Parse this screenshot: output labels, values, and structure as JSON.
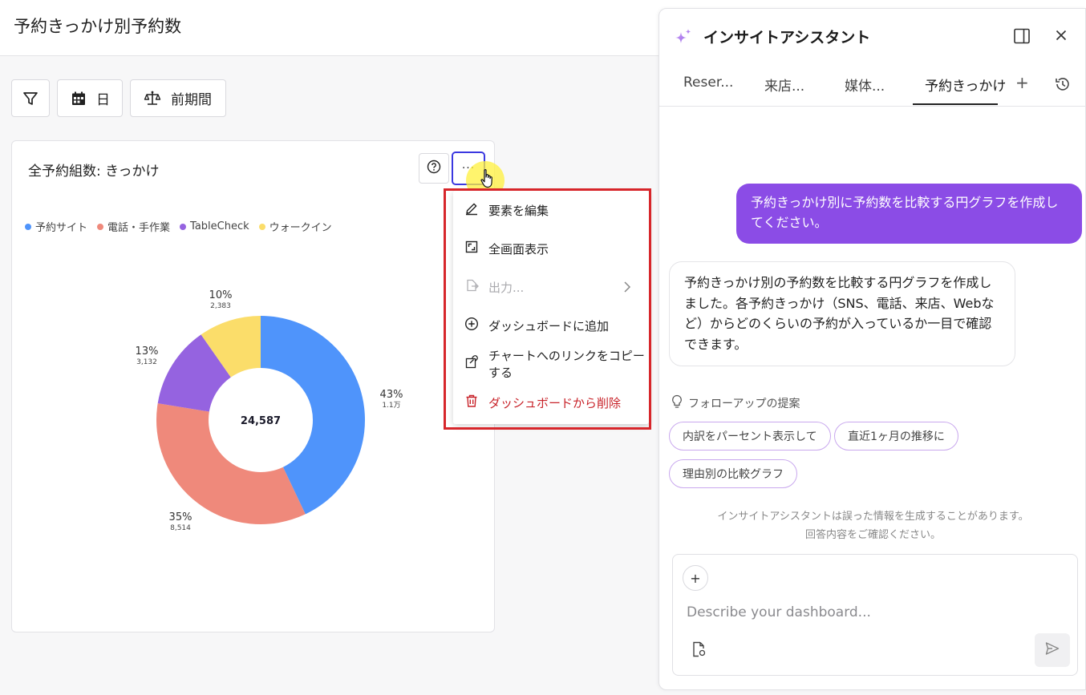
{
  "page": {
    "title": "予約きっかけ別予約数"
  },
  "toolbar": {
    "filter_icon": "filter-icon",
    "date_label": "日",
    "compare_label": "前期間"
  },
  "card": {
    "title": "全予約組数: きっかけ",
    "more_label": "···"
  },
  "legend": [
    {
      "label": "予約サイト",
      "color": "#4f94fb"
    },
    {
      "label": "電話・手作業",
      "color": "#ef897b"
    },
    {
      "label": "TableCheck",
      "color": "#9563e0"
    },
    {
      "label": "ウォークイン",
      "color": "#fbdd6a"
    }
  ],
  "chart_data": {
    "type": "pie",
    "donut": true,
    "center_label": "24,587",
    "slices": [
      {
        "name": "予約サイト",
        "percent_label": "43%",
        "value_label": "1.1万",
        "value": 10558,
        "color": "#4f94fb"
      },
      {
        "name": "電話・手作業",
        "percent_label": "35%",
        "value_label": "8,514",
        "value": 8514,
        "color": "#ef897b"
      },
      {
        "name": "TableCheck",
        "percent_label": "13%",
        "value_label": "3,132",
        "value": 3132,
        "color": "#9563e0"
      },
      {
        "name": "ウォークイン",
        "percent_label": "10%",
        "value_label": "2,383",
        "value": 2383,
        "color": "#fbdd6a"
      }
    ]
  },
  "menu": {
    "items": [
      {
        "label": "要素を編集",
        "icon": "pencil-icon"
      },
      {
        "label": "全画面表示",
        "icon": "fullscreen-icon"
      },
      {
        "label": "出力...",
        "icon": "export-icon"
      },
      {
        "label": "ダッシュボードに追加",
        "icon": "plus-circle-icon"
      },
      {
        "label": "チャートへのリンクをコピーする",
        "icon": "link-copy-icon"
      },
      {
        "label": "ダッシュボードから削除",
        "icon": "trash-icon"
      }
    ]
  },
  "assistant": {
    "title": "インサイトアシスタント",
    "tabs": [
      "Reser...",
      "来店...",
      "媒体...",
      "予約きっかけ"
    ],
    "active_tab": "予約きっかけ",
    "user_message": "予約きっかけ別に予約数を比較する円グラフを作成してください。",
    "ai_message": "予約きっかけ別の予約数を比較する円グラフを作成しました。各予約きっかけ（SNS、電話、来店、Webなど）からどのくらいの予約が入っているか一目で確認できます。",
    "followup_heading": "フォローアップの提案",
    "suggestions": [
      "内訳をパーセント表示して",
      "直近1ヶ月の推移に",
      "理由別の比較グラフ"
    ],
    "disclaimer_line1": "インサイトアシスタントは誤った情報を生成することがあります。",
    "disclaimer_line2": "回答内容をご確認ください。",
    "input_placeholder": "Describe your dashboard...",
    "accent_color": "#8b4ce6"
  }
}
